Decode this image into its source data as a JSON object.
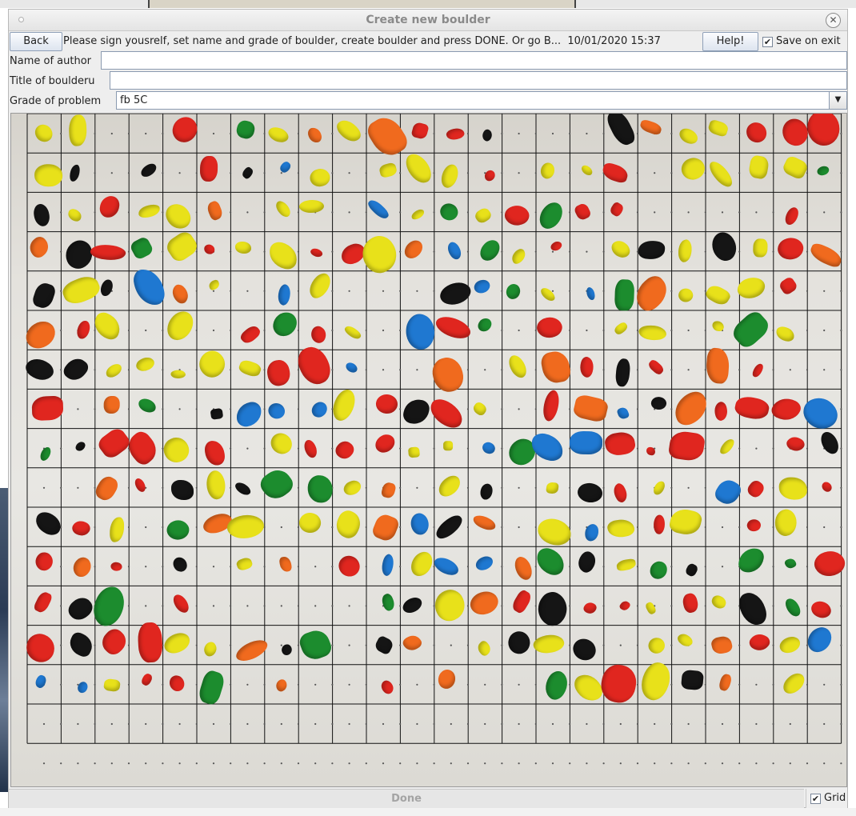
{
  "window": {
    "title": "Create new boulder"
  },
  "toolbar": {
    "back_label": "Back",
    "message": "Please sign yousrelf, set name and grade of boulder, create boulder and press DONE. Or go B...",
    "datetime": "10/01/2020 15:37",
    "help_label": "Help!",
    "save_on_exit_label": "Save on exit",
    "save_on_exit_checked": true
  },
  "form": {
    "author_label": "Name of author",
    "author_value": "",
    "title_label": "Title of boulderu",
    "title_value": "",
    "grade_label": "Grade of problem",
    "grade_value": "fb 5C"
  },
  "footer": {
    "done_label": "Done",
    "grid_label": "Grid",
    "grid_checked": true
  },
  "colors": {
    "hold_red": "#e0261f",
    "hold_yellow": "#e8e11a",
    "hold_blue": "#1f78d1",
    "hold_black": "#151515",
    "hold_green": "#1c8c2e",
    "hold_orange": "#f06a1e"
  }
}
